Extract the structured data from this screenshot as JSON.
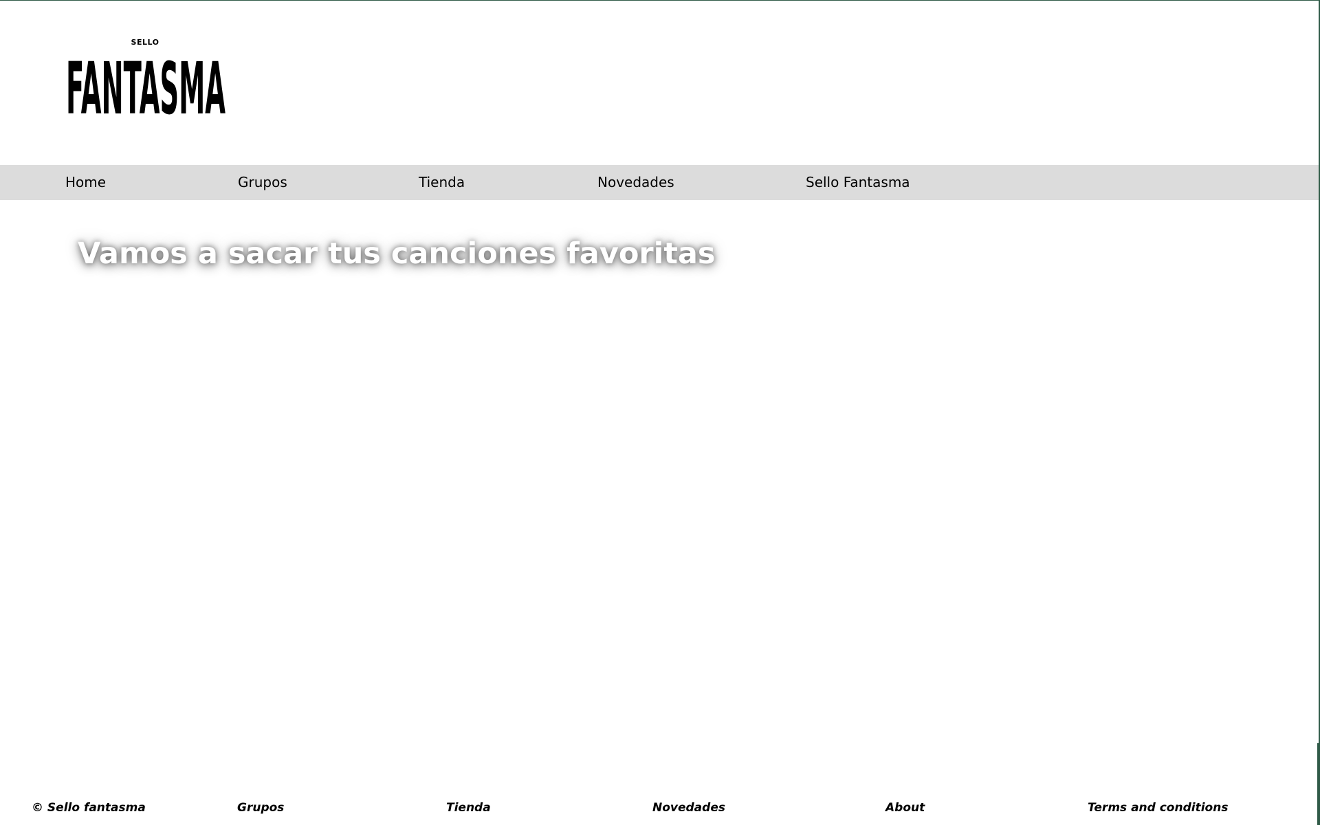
{
  "brand": {
    "logo_small_text": "SELLO",
    "logo_main_text": "FANTASMA"
  },
  "nav": {
    "items": [
      {
        "label": "Home"
      },
      {
        "label": "Grupos"
      },
      {
        "label": "Tienda"
      },
      {
        "label": "Novedades"
      },
      {
        "label": "Sello Fantasma"
      }
    ]
  },
  "hero": {
    "title": "Vamos a sacar tus canciones favoritas"
  },
  "footer": {
    "copyright": "© Sello fantasma",
    "links": [
      {
        "label": "Grupos"
      },
      {
        "label": "Tienda"
      },
      {
        "label": "Novedades"
      },
      {
        "label": "About"
      },
      {
        "label": "Terms and conditions"
      }
    ]
  },
  "colors": {
    "nav_background": "#dcdcdc",
    "frame_border": "#2f5a47",
    "hero_text": "#ffffff"
  }
}
